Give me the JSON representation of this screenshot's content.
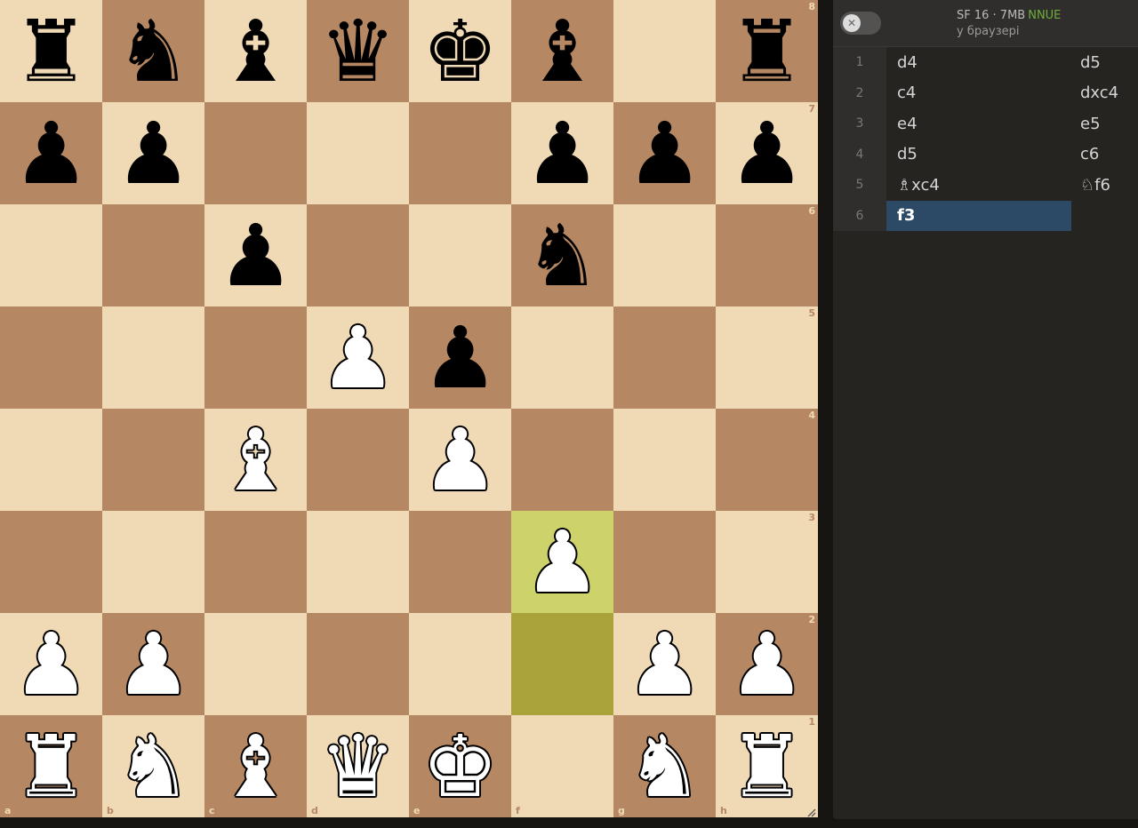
{
  "board": {
    "ranks": [
      "8",
      "7",
      "6",
      "5",
      "4",
      "3",
      "2",
      "1"
    ],
    "files": [
      "a",
      "b",
      "c",
      "d",
      "e",
      "f",
      "g",
      "h"
    ],
    "last_move": {
      "from": "f2",
      "to": "f3"
    },
    "position": [
      [
        "r",
        "n",
        "b",
        "q",
        "k",
        "b",
        "",
        "r"
      ],
      [
        "p",
        "p",
        "",
        "",
        "",
        "p",
        "p",
        "p"
      ],
      [
        "",
        "",
        "p",
        "",
        "",
        "n",
        "",
        ""
      ],
      [
        "",
        "",
        "",
        "P",
        "p",
        "",
        "",
        ""
      ],
      [
        "",
        "",
        "B",
        "",
        "P",
        "",
        "",
        ""
      ],
      [
        "",
        "",
        "",
        "",
        "",
        "P",
        "",
        ""
      ],
      [
        "P",
        "P",
        "",
        "",
        "",
        "",
        "P",
        "P"
      ],
      [
        "R",
        "N",
        "B",
        "Q",
        "K",
        "",
        "N",
        "R"
      ]
    ],
    "colors": {
      "light": "#f0d9b5",
      "dark": "#b58863",
      "highlight_to": "#cdd26a",
      "highlight_from": "#aaa23a"
    }
  },
  "engine": {
    "toggle_icon": "close-icon",
    "name": "SF 16 · 7MB",
    "nnue": "NNUE",
    "location": "у браузері"
  },
  "moves": [
    {
      "n": "1",
      "white": "d4",
      "black": "d5"
    },
    {
      "n": "2",
      "white": "c4",
      "black": "dxc4"
    },
    {
      "n": "3",
      "white": "e4",
      "black": "e5"
    },
    {
      "n": "4",
      "white": "d5",
      "black": "c6"
    },
    {
      "n": "5",
      "white": "♗xc4",
      "black": "♘f6"
    },
    {
      "n": "6",
      "white": "f3",
      "black": ""
    }
  ],
  "active_move": "f3"
}
